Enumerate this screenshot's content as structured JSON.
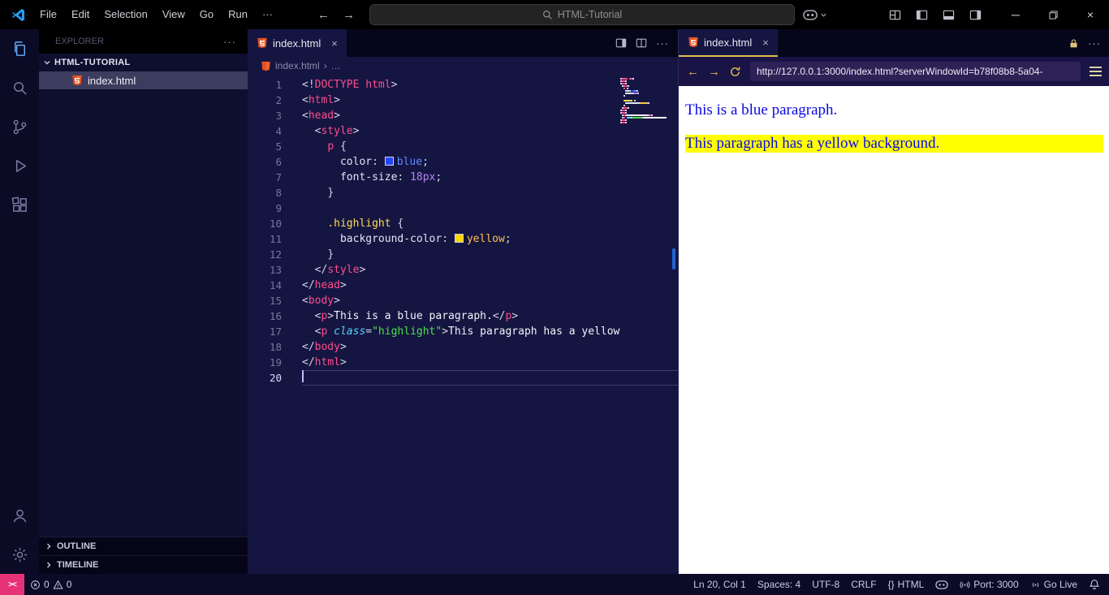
{
  "title_bar": {
    "menus": [
      "File",
      "Edit",
      "Selection",
      "View",
      "Go",
      "Run"
    ],
    "more_label": "···",
    "search_text": "HTML-Tutorial"
  },
  "explorer": {
    "title": "EXPLORER",
    "folder_name": "HTML-TUTORIAL",
    "file_name": "index.html",
    "outline_label": "OUTLINE",
    "timeline_label": "TIMELINE"
  },
  "editor": {
    "tab_label": "index.html",
    "breadcrumb_file": "index.html",
    "breadcrumb_more": "…",
    "cursor_line": 20,
    "lines": [
      [
        [
          "<!",
          "pu"
        ],
        [
          "DOCTYPE",
          "tg"
        ],
        [
          " ",
          "tx"
        ],
        [
          "html",
          "tg"
        ],
        [
          ">",
          "pu"
        ]
      ],
      [
        [
          "<",
          "pu"
        ],
        [
          "html",
          "tg"
        ],
        [
          ">",
          "pu"
        ]
      ],
      [
        [
          "<",
          "pu"
        ],
        [
          "head",
          "tg"
        ],
        [
          ">",
          "pu"
        ]
      ],
      [
        [
          "  ",
          "tx"
        ],
        [
          "<",
          "pu"
        ],
        [
          "style",
          "tg"
        ],
        [
          ">",
          "pu"
        ]
      ],
      [
        [
          "    ",
          "tx"
        ],
        [
          "p",
          "tg"
        ],
        [
          " ",
          "tx"
        ],
        [
          "{",
          "pu"
        ]
      ],
      [
        [
          "      ",
          "tx"
        ],
        [
          "color",
          "pr"
        ],
        [
          ": ",
          "pu"
        ],
        [
          "",
          "sw-b"
        ],
        [
          "blue",
          "vb"
        ],
        [
          ";",
          "pu"
        ]
      ],
      [
        [
          "      ",
          "tx"
        ],
        [
          "font-size",
          "pr"
        ],
        [
          ": ",
          "pu"
        ],
        [
          "18px",
          "nu"
        ],
        [
          ";",
          "pu"
        ]
      ],
      [
        [
          "    ",
          "tx"
        ],
        [
          "}",
          "pu"
        ]
      ],
      [],
      [
        [
          "    ",
          "tx"
        ],
        [
          ".highlight",
          "cs"
        ],
        [
          " ",
          "tx"
        ],
        [
          "{",
          "pu"
        ]
      ],
      [
        [
          "      ",
          "tx"
        ],
        [
          "background-color",
          "pr"
        ],
        [
          ": ",
          "pu"
        ],
        [
          "",
          "sw-y"
        ],
        [
          "yellow",
          "vy"
        ],
        [
          ";",
          "pu"
        ]
      ],
      [
        [
          "    ",
          "tx"
        ],
        [
          "}",
          "pu"
        ]
      ],
      [
        [
          "  ",
          "tx"
        ],
        [
          "</",
          "pu"
        ],
        [
          "style",
          "tg"
        ],
        [
          ">",
          "pu"
        ]
      ],
      [
        [
          "</",
          "pu"
        ],
        [
          "head",
          "tg"
        ],
        [
          ">",
          "pu"
        ]
      ],
      [
        [
          "<",
          "pu"
        ],
        [
          "body",
          "tg"
        ],
        [
          ">",
          "pu"
        ]
      ],
      [
        [
          "  ",
          "tx"
        ],
        [
          "<",
          "pu"
        ],
        [
          "p",
          "tg"
        ],
        [
          ">",
          "pu"
        ],
        [
          "This is a blue paragraph.",
          "tx"
        ],
        [
          "</",
          "pu"
        ],
        [
          "p",
          "tg"
        ],
        [
          ">",
          "pu"
        ]
      ],
      [
        [
          "  ",
          "tx"
        ],
        [
          "<",
          "pu"
        ],
        [
          "p",
          "tg"
        ],
        [
          " ",
          "tx"
        ],
        [
          "class",
          "at"
        ],
        [
          "=",
          "pu"
        ],
        [
          "\"highlight\"",
          "st"
        ],
        [
          ">",
          "pu"
        ],
        [
          "This paragraph has a yellow",
          "tx"
        ]
      ],
      [
        [
          "</",
          "pu"
        ],
        [
          "body",
          "tg"
        ],
        [
          ">",
          "pu"
        ]
      ],
      [
        [
          "</",
          "pu"
        ],
        [
          "html",
          "tg"
        ],
        [
          ">",
          "pu"
        ]
      ],
      []
    ]
  },
  "preview": {
    "tab_label": "index.html",
    "url": "http://127.0.0.1:3000/index.html?serverWindowId=b78f08b8-5a04-",
    "paragraph1": "This is a blue paragraph.",
    "paragraph2": "This paragraph has a yellow background.",
    "text_color": "#0909e8",
    "highlight_color": "#ffff00"
  },
  "status_bar": {
    "error_count": "0",
    "warning_count": "0",
    "cursor_position": "Ln 20, Col 1",
    "indentation": "Spaces: 4",
    "encoding": "UTF-8",
    "eol": "CRLF",
    "language": "HTML",
    "port": "Port: 3000",
    "go_live": "Go Live"
  },
  "icons": {
    "back": "←",
    "forward": "→",
    "close": "×",
    "more": "···",
    "minimize": "─",
    "chevron_right": "›",
    "braces": "{}",
    "remote": "><"
  },
  "theme_colors": {
    "editor_background": "#151542",
    "tag_pink": "#ff4d8b",
    "string_green": "#4be04b",
    "accent_yellow": "#dfc04a",
    "remote_pink": "#e73277",
    "html_icon_orange": "#e44d26"
  }
}
